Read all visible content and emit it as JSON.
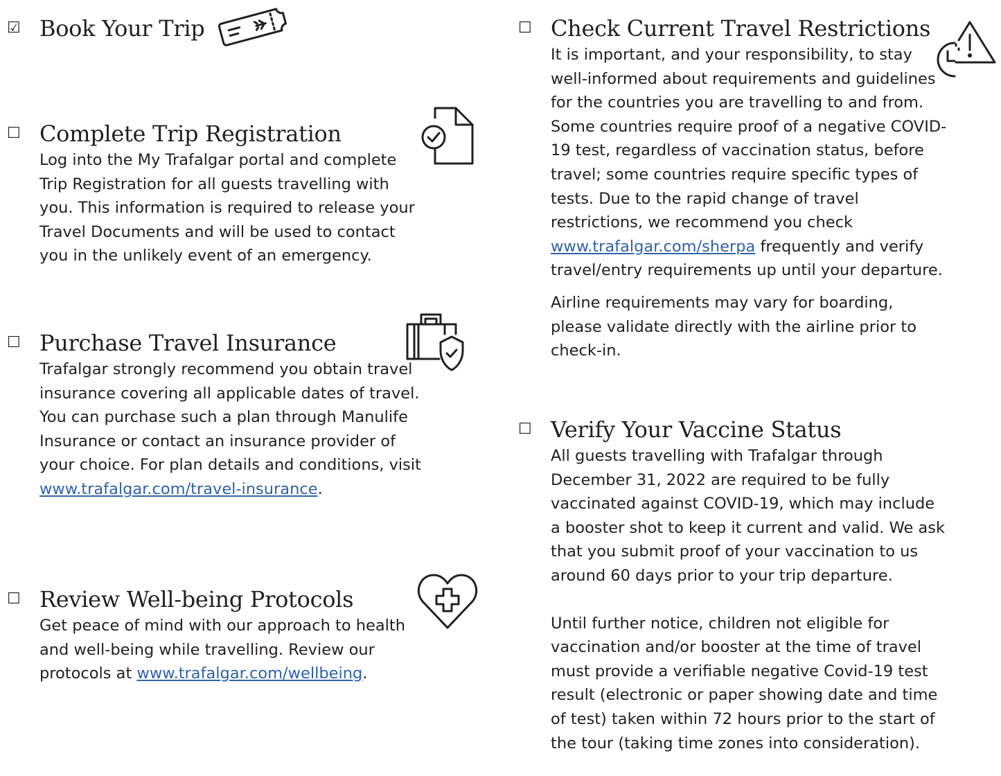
{
  "colors": {
    "text": "#231f20",
    "link": "#2f63a8"
  },
  "checklist": [
    {
      "id": "book",
      "box_glyph": "☑",
      "icon": "ticket-icon",
      "title": "Book Your Trip"
    },
    {
      "id": "register",
      "box_glyph": "☐",
      "icon": "document-check-icon",
      "title": "Complete Trip Registration",
      "body": "Log into the My Trafalgar portal and complete Trip Registration for all guests travelling with you. This information is required to release your Travel Documents and will be used to contact you in the unlikely event of an emergency."
    },
    {
      "id": "insurance",
      "box_glyph": "☐",
      "icon": "suitcase-shield-icon",
      "title": "Purchase Travel Insurance",
      "body_before": "Trafalgar strongly recommend you obtain travel insurance covering all applicable dates of travel. You can purchase such a plan through Manulife Insurance or contact an insurance provider of your choice. For plan details and conditions, visit ",
      "link": "www.trafalgar.com/travel-insurance",
      "body_after": "."
    },
    {
      "id": "wellbeing",
      "box_glyph": "☐",
      "icon": "heart-cross-icon",
      "title": "Review Well-being Protocols",
      "body_before": "Get peace of mind with our approach to health and well-being while travelling. Review our protocols at ",
      "link": "www.trafalgar.com/wellbeing",
      "body_after": "."
    },
    {
      "id": "restrictions",
      "box_glyph": "☐",
      "icon": "clock-warning-icon",
      "title": "Check Current Travel Restrictions",
      "body_before": "It is important, and your responsibility, to stay well-informed about requirements and guidelines for the countries you are travelling to and from. Some countries require proof of a negative COVID-19 test, regardless of vaccination status, before travel; some countries require specific types of tests. Due to the rapid change of travel restrictions, we recommend you check ",
      "link": "www.trafalgar.com/sherpa",
      "body_after": " frequently and verify travel/entry requirements up until your departure.",
      "body_2": "Airline requirements may vary for boarding, please validate directly with the airline prior to check-in."
    },
    {
      "id": "vaccine",
      "box_glyph": "☐",
      "title": "Verify Your Vaccine Status",
      "body": "All guests travelling with Trafalgar through December 31, 2022 are required to be fully vaccinated against COVID-19, which may include a booster shot to keep it current and valid. We ask that you submit proof of your vaccination to us around 60 days prior to your trip departure.",
      "body_2": "Until further notice, children not eligible for vaccination and/or booster at the time of travel must provide a verifiable negative Covid-19 test result (electronic or paper showing date and time of test) taken within 72 hours prior to the start of the tour (taking time zones into consideration)."
    }
  ]
}
